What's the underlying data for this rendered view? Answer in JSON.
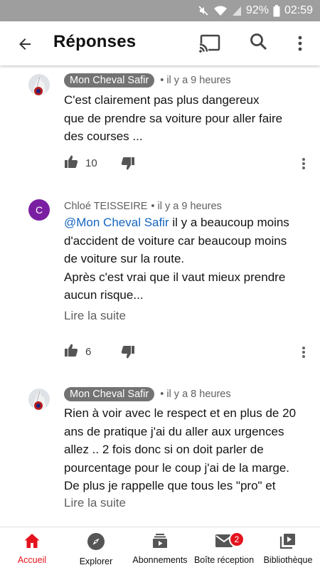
{
  "status_bar": {
    "battery": "92%",
    "time": "02:59"
  },
  "app_bar": {
    "title": "Réponses"
  },
  "comments": [
    {
      "author": "Mon Cheval Safir",
      "time": "il y a 9 heures",
      "lines": [
        "C'est clairement pas plus dangereux",
        "que de prendre sa voiture pour aller faire",
        "des courses ..."
      ],
      "likes": "10"
    },
    {
      "avatar_letter": "C",
      "author": "Chloé TEISSEIRE",
      "time": "il y a 9 heures",
      "mention": "@Mon Cheval Safir",
      "first_line_rest": " il y a beaucoup moins",
      "lines": [
        "d'accident de voiture car beaucoup moins",
        "de voiture sur la route.",
        "Après c'est vrai que il vaut mieux prendre",
        "aucun risque..."
      ],
      "read_more": "Lire la suite",
      "likes": "6"
    },
    {
      "author": "Mon Cheval Safir",
      "time": "il y a 8 heures",
      "lines": [
        "Rien à voir avec le respect et en plus de 20",
        "ans de pratique j'ai du aller aux urgences",
        "allez .. 2 fois donc si on doit parler de",
        "pourcentage pour le coup j'ai de la marge.",
        "De plus je rappelle que tous les \"pro\" et"
      ],
      "read_more": "Lire la suite"
    }
  ],
  "bottom_nav": {
    "items": [
      "Accueil",
      "Explorer",
      "Abonnements",
      "Boîte réception",
      "Bibliothèque"
    ],
    "inbox_badge": "2",
    "active_color": "#e5131e"
  }
}
